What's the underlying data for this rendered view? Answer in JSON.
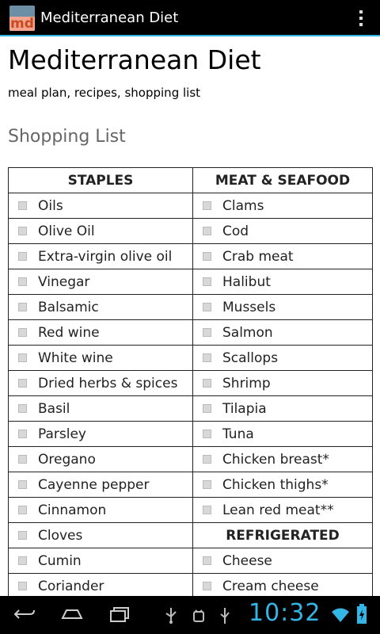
{
  "app": {
    "title": "Mediterranean Diet",
    "icon_text": "md"
  },
  "page": {
    "title": "Mediterranean Diet",
    "subtitle": "meal plan, recipes, shopping list",
    "section": "Shopping List"
  },
  "shopping": {
    "rows": [
      [
        {
          "type": "header",
          "text": "STAPLES"
        },
        {
          "type": "header",
          "text": "MEAT & SEAFOOD"
        }
      ],
      [
        {
          "type": "item",
          "text": "Oils"
        },
        {
          "type": "item",
          "text": "Clams"
        }
      ],
      [
        {
          "type": "item",
          "text": "Olive Oil"
        },
        {
          "type": "item",
          "text": "Cod"
        }
      ],
      [
        {
          "type": "item",
          "text": "Extra-virgin olive oil"
        },
        {
          "type": "item",
          "text": "Crab meat"
        }
      ],
      [
        {
          "type": "item",
          "text": "Vinegar"
        },
        {
          "type": "item",
          "text": "Halibut"
        }
      ],
      [
        {
          "type": "item",
          "text": "Balsamic"
        },
        {
          "type": "item",
          "text": "Mussels"
        }
      ],
      [
        {
          "type": "item",
          "text": "Red wine"
        },
        {
          "type": "item",
          "text": "Salmon"
        }
      ],
      [
        {
          "type": "item",
          "text": "White wine"
        },
        {
          "type": "item",
          "text": "Scallops"
        }
      ],
      [
        {
          "type": "item",
          "text": "Dried herbs & spices"
        },
        {
          "type": "item",
          "text": "Shrimp"
        }
      ],
      [
        {
          "type": "item",
          "text": "Basil"
        },
        {
          "type": "item",
          "text": "Tilapia"
        }
      ],
      [
        {
          "type": "item",
          "text": "Parsley"
        },
        {
          "type": "item",
          "text": "Tuna"
        }
      ],
      [
        {
          "type": "item",
          "text": "Oregano"
        },
        {
          "type": "item",
          "text": "Chicken breast*"
        }
      ],
      [
        {
          "type": "item",
          "text": "Cayenne pepper"
        },
        {
          "type": "item",
          "text": "Chicken thighs*"
        }
      ],
      [
        {
          "type": "item",
          "text": "Cinnamon"
        },
        {
          "type": "item",
          "text": "Lean red meat**"
        }
      ],
      [
        {
          "type": "item",
          "text": "Cloves"
        },
        {
          "type": "header",
          "text": "REFRIGERATED"
        }
      ],
      [
        {
          "type": "item",
          "text": "Cumin"
        },
        {
          "type": "item",
          "text": "Cheese"
        }
      ],
      [
        {
          "type": "item",
          "text": "Coriander"
        },
        {
          "type": "item",
          "text": "Cream cheese"
        }
      ]
    ]
  },
  "status": {
    "time": "10:32"
  },
  "colors": {
    "accent": "#33b5e5",
    "header_text": "#800080"
  },
  "icons": [
    "overflow-menu-icon",
    "back-icon",
    "home-icon",
    "recents-icon",
    "usb-icon",
    "android-debug-icon",
    "usb-connection-icon",
    "wifi-icon",
    "battery-charging-icon"
  ]
}
